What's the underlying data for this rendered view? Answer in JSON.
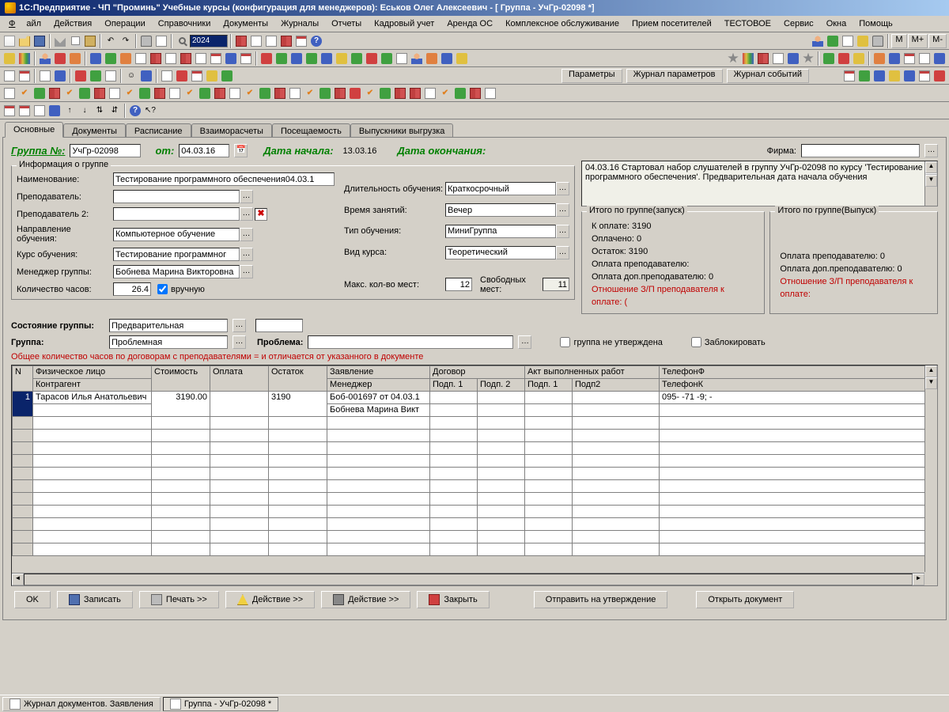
{
  "title": "1С:Предприятие - ЧП \"Проминь\" Учебные курсы (конфигурация для менеджеров): Еськов Олег Алексеевич - [ Группа - УчГр-02098 *]",
  "menu": [
    "Файл",
    "Действия",
    "Операции",
    "Справочники",
    "Документы",
    "Журналы",
    "Отчеты",
    "Кадровый учет",
    "Аренда ОС",
    "Комплексное обслуживание",
    "Прием посетителей",
    "ТЕСТОВОЕ",
    "Сервис",
    "Окна",
    "Помощь"
  ],
  "tb_period": "2024",
  "tb_mbtns": [
    "M",
    "M+",
    "M-"
  ],
  "param_btns": [
    "Параметры",
    "Журнал параметров",
    "Журнал событий"
  ],
  "tabs": [
    "Основные",
    "Документы",
    "Расписание",
    "Взаиморасчеты",
    "Посещаемость",
    "Выпускники выгрузка"
  ],
  "header": {
    "group_lbl": "Группа №:",
    "group_val": "УчГр-02098",
    "from_lbl": "от:",
    "from_val": "04.03.16",
    "start_lbl": "Дата начала:",
    "start_val": "13.03.16",
    "end_lbl": "Дата окончания:",
    "firm_lbl": "Фирма:"
  },
  "info_legend": "Информация о группе",
  "fields": {
    "name_lbl": "Наименование:",
    "name_val": "Тестирование программного обеспечения04.03.1",
    "teacher_lbl": "Преподаватель:",
    "teacher2_lbl": "Преподаватель 2:",
    "dir_lbl": "Направление обучения:",
    "dir_val": "Компьютерное обучение",
    "course_lbl": "Курс обучения:",
    "course_val": "Тестирование программног",
    "mgr_lbl": "Менеджер группы:",
    "mgr_val": "Бобнева Марина Викторовна",
    "hours_lbl": "Количество часов:",
    "hours_val": "26.4",
    "manual_chk": "вручную",
    "dur_lbl": "Длительность обучения:",
    "dur_val": "Краткосрочный",
    "time_lbl": "Время занятий:",
    "time_val": "Вечер",
    "type_lbl": "Тип обучения:",
    "type_val": "МиниГруппа",
    "kind_lbl": "Вид курса:",
    "kind_val": "Теоретический",
    "max_lbl": "Макс. кол-во мест:",
    "max_val": "12",
    "free_lbl": "Свободных мест:",
    "free_val": "11"
  },
  "state": {
    "state_lbl": "Состояние группы:",
    "state_val": "Предварительная",
    "group_lbl": "Группа:",
    "group_val": "Проблемная",
    "problem_lbl": "Проблема:",
    "chk1": "группа не утверждена",
    "chk2": "Заблокировать"
  },
  "warning": "Общее количество часов по договорам с преподавателями =  и отличается от указанного в документе",
  "log": "04.03.16 Стартовал набор слушателей в группу УчГр-02098 по курсу 'Тестирование программного обеспечения'. Предварительная дата начала обучения",
  "totals_start": {
    "legend": "Итого по группе(запуск)",
    "l1": "К оплате: 3190",
    "l2": "Оплачено: 0",
    "l3": "Остаток: 3190",
    "l4": "Оплата преподавателю:",
    "l5": "Оплата доп.преподавателю: 0",
    "l6": "Отношение З/П преподавателя к оплате:  ("
  },
  "totals_end": {
    "legend": "Итого по группе(Выпуск)",
    "l1": "Оплата преподавателю: 0",
    "l2": "Оплата доп.преподавателю: 0",
    "l3": "Отношение З/П преподавателя к оплате:"
  },
  "grid": {
    "headers_top": [
      "N",
      "Физическое лицо",
      "Стоимость",
      "Оплата",
      "Остаток",
      "Заявление",
      "Договор",
      "",
      "Акт выполненных работ",
      "",
      "ТелефонФ"
    ],
    "headers_bot": [
      "",
      "Контрагент",
      "",
      "",
      "",
      "Менеджер",
      "Подп. 1",
      "Подп. 2",
      "Подп. 1",
      "Подп2",
      "ТелефонК"
    ],
    "row": {
      "n": "1",
      "person": "Тарасов Илья Анатольевич",
      "cost": "3190.00",
      "paid": "",
      "rest": "3190",
      "app": "Боб-001697 от 04.03.1",
      "mgr": "Бобнева Марина Викт",
      "phone": "095-      -71  -9;   -"
    }
  },
  "buttons": {
    "ok": "OK",
    "save": "Записать",
    "print": "Печать >>",
    "act1": "Действие >>",
    "act2": "Действие >>",
    "close": "Закрыть",
    "approve": "Отправить на утверждение",
    "open": "Открыть документ"
  },
  "taskbar": {
    "t1": "Журнал документов. Заявления",
    "t2": "Группа - УчГр-02098 *"
  }
}
